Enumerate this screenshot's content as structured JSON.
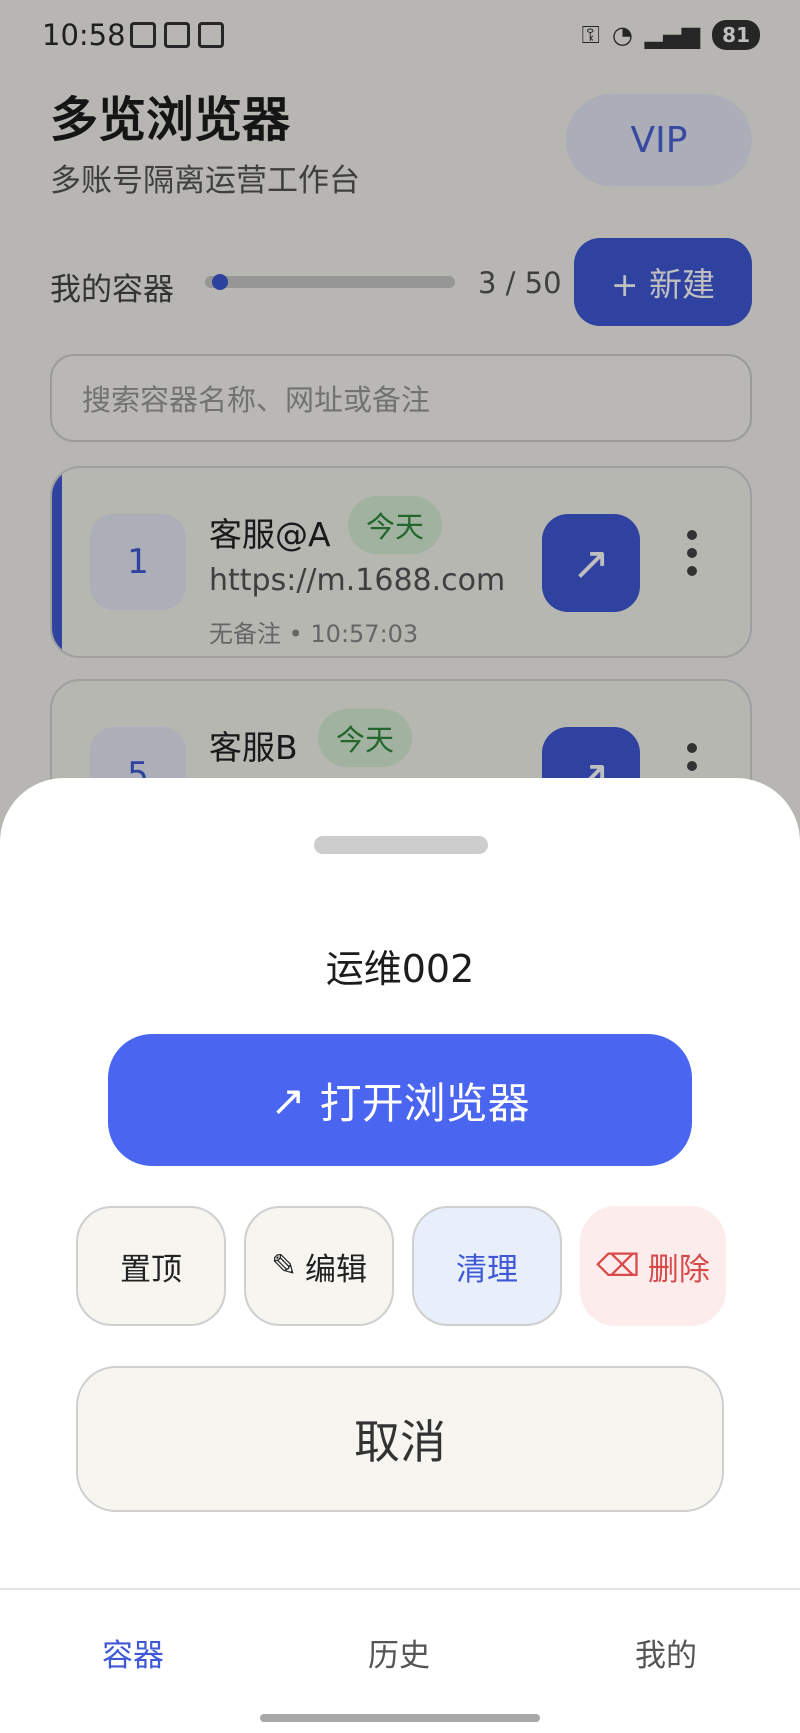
{
  "status_bar": {
    "time": "10:58",
    "battery": "81",
    "wifi_label": "6"
  },
  "header": {
    "title": "多览浏览器",
    "subtitle": "多账号隔离运营工作台",
    "vip_label": "VIP"
  },
  "containers": {
    "label": "我的容器",
    "count_text": "3 / 50",
    "progress": 0.06,
    "new_label": "+ 新建"
  },
  "search": {
    "placeholder": "搜索容器名称、网址或备注"
  },
  "cards": [
    {
      "index": "1",
      "name": "客服@A",
      "badge": "今天",
      "url": "https://m.1688.com",
      "meta": "无备注 • 10:57:03",
      "open_icon": "↗"
    },
    {
      "index": "5",
      "name": "客服B",
      "badge": "今天",
      "open_icon": "↗"
    }
  ],
  "sheet": {
    "title": "运维002",
    "open_label": "打开浏览器",
    "open_icon": "↗",
    "actions": {
      "pin": "置顶",
      "edit": "编辑",
      "edit_icon": "✎",
      "clean": "清理",
      "delete": "删除",
      "delete_icon": "⌫"
    },
    "cancel": "取消"
  },
  "nav": {
    "containers": "容器",
    "history": "历史",
    "mine": "我的"
  },
  "colors": {
    "accent": "#3f59d6",
    "primary_button": "#4a66f0",
    "badge_green": "#2f8a3c",
    "danger": "#d84a4a"
  }
}
